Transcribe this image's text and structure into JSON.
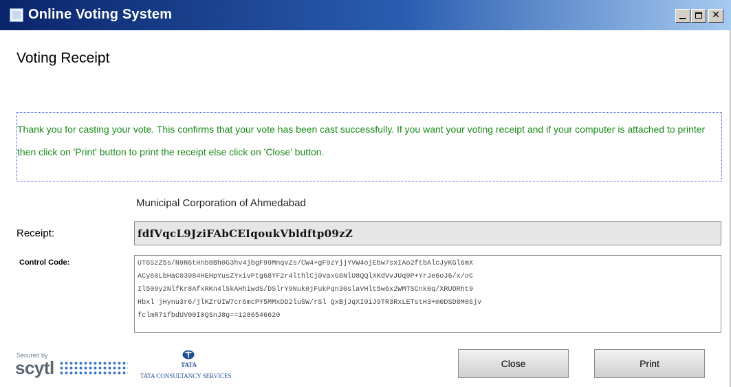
{
  "window": {
    "title": "Online Voting System"
  },
  "page": {
    "title": "Voting Receipt",
    "message": "Thank you for casting your vote. This confirms that your vote has been cast successfully. If you want your voting receipt and if your computer is attached to printer then click on 'Print' button to print the receipt else click on 'Close' button.",
    "organization": "Municipal Corporation of Ahmedabad"
  },
  "receipt": {
    "label": "Receipt:",
    "value": "fdfVqcL9JziFAbCEIqoukVbldftp09zZ"
  },
  "control_code": {
    "label": "Control Code:",
    "lines": [
      "UT6SzZ5s/N9N6tHnb8Bh0G3hv4jbgF99MnqvZs/CW4+gF9zYjjYVW4ojEbw7sxIAo2ftbAlcJyKGl6mX",
      "ACy60LbHaC03984HEHpYusZYxivPtg68YF2r4lthlCj0vaxG6NlU8QQlXKdVvJUq9P+YrJe6oJ6/x/oC",
      "Il509y2NlfKr8AfxRKn4lSkAHhiwdS/DSlrY9Nuk0jFukPqn30slaVHlt5w6x2WMTSCnk0q/XRUDRht9",
      "Hbxl jHynu3r6/jlKZrUIW7cr6mcPY5MMxDD2luSW/rSl QxBjJqXI0iJ9TR3RxLETstH3+m0DSD8M0Sjv",
      "fclmR71fbdUV00I0QSnJ8g==1286546620"
    ]
  },
  "footer": {
    "secured_by": "Secured by",
    "scytl": "scytl",
    "tata": "TATA",
    "tcs": "TATA CONSULTANCY SERVICES"
  },
  "buttons": {
    "close": "Close",
    "print": "Print"
  },
  "colors": {
    "titlebar_start": "#0a246a",
    "titlebar_end": "#a6caf0",
    "message_text": "#1a8a1a",
    "message_border": "#3c4fd6"
  }
}
